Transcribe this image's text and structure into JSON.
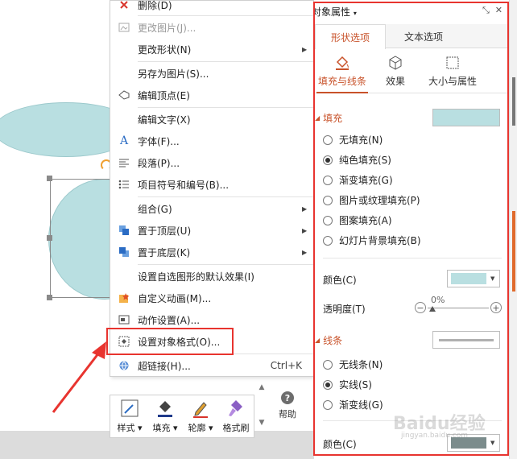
{
  "context_menu": {
    "items": [
      {
        "label": "删除(D)",
        "disabled": false,
        "submenu": false,
        "icon": "delete-x-icon"
      },
      {
        "label": "更改图片(J)...",
        "disabled": true,
        "submenu": false,
        "icon": "change-picture-icon"
      },
      {
        "label": "更改形状(N)",
        "disabled": false,
        "submenu": true,
        "icon": ""
      },
      {
        "label": "另存为图片(S)...",
        "disabled": false,
        "submenu": false,
        "icon": ""
      },
      {
        "label": "编辑顶点(E)",
        "disabled": false,
        "submenu": false,
        "icon": "edit-points-icon"
      },
      {
        "label": "编辑文字(X)",
        "disabled": false,
        "submenu": false,
        "icon": ""
      },
      {
        "label": "字体(F)...",
        "disabled": false,
        "submenu": false,
        "icon": "font-icon"
      },
      {
        "label": "段落(P)...",
        "disabled": false,
        "submenu": false,
        "icon": "paragraph-icon"
      },
      {
        "label": "项目符号和编号(B)...",
        "disabled": false,
        "submenu": false,
        "icon": "bullets-icon"
      },
      {
        "label": "组合(G)",
        "disabled": false,
        "submenu": true,
        "icon": ""
      },
      {
        "label": "置于顶层(U)",
        "disabled": false,
        "submenu": true,
        "icon": "bring-to-front-icon"
      },
      {
        "label": "置于底层(K)",
        "disabled": false,
        "submenu": true,
        "icon": "send-to-back-icon"
      },
      {
        "label": "设置自选图形的默认效果(I)",
        "disabled": false,
        "submenu": false,
        "icon": ""
      },
      {
        "label": "自定义动画(M)...",
        "disabled": false,
        "submenu": false,
        "icon": "custom-animation-icon"
      },
      {
        "label": "动作设置(A)...",
        "disabled": false,
        "submenu": false,
        "icon": "action-settings-icon"
      },
      {
        "label": "设置对象格式(O)...",
        "disabled": false,
        "submenu": false,
        "icon": "format-object-icon"
      },
      {
        "label": "超链接(H)...",
        "disabled": false,
        "submenu": false,
        "icon": "hyperlink-icon",
        "shortcut": "Ctrl+K"
      }
    ]
  },
  "mini_toolbar": {
    "style": "样式",
    "fill": "填充",
    "outline": "轮廓",
    "format_painter": "格式刷",
    "help": "帮助"
  },
  "panel": {
    "title": "对象属性",
    "tabs": [
      "形状选项",
      "文本选项"
    ],
    "subtabs": [
      "填充与线条",
      "效果",
      "大小与属性"
    ],
    "fill": {
      "heading": "填充",
      "options": [
        "无填充(N)",
        "纯色填充(S)",
        "渐变填充(G)",
        "图片或纹理填充(P)",
        "图案填充(A)",
        "幻灯片背景填充(B)"
      ],
      "selected": 1,
      "color_label": "颜色(C)",
      "transparency_label": "透明度(T)",
      "transparency_value": "0%",
      "transparency_fraction": 0
    },
    "line": {
      "heading": "线条",
      "options": [
        "无线条(N)",
        "实线(S)",
        "渐变线(G)"
      ],
      "selected": 1,
      "color_label": "颜色(C)"
    }
  },
  "watermark": {
    "text": "Baidu经验",
    "subtext": "jingyan.baidu.com"
  },
  "colors": {
    "accent": "#c8522a",
    "highlight": "#e8342f",
    "shape_fill": "#b9dfe1"
  }
}
